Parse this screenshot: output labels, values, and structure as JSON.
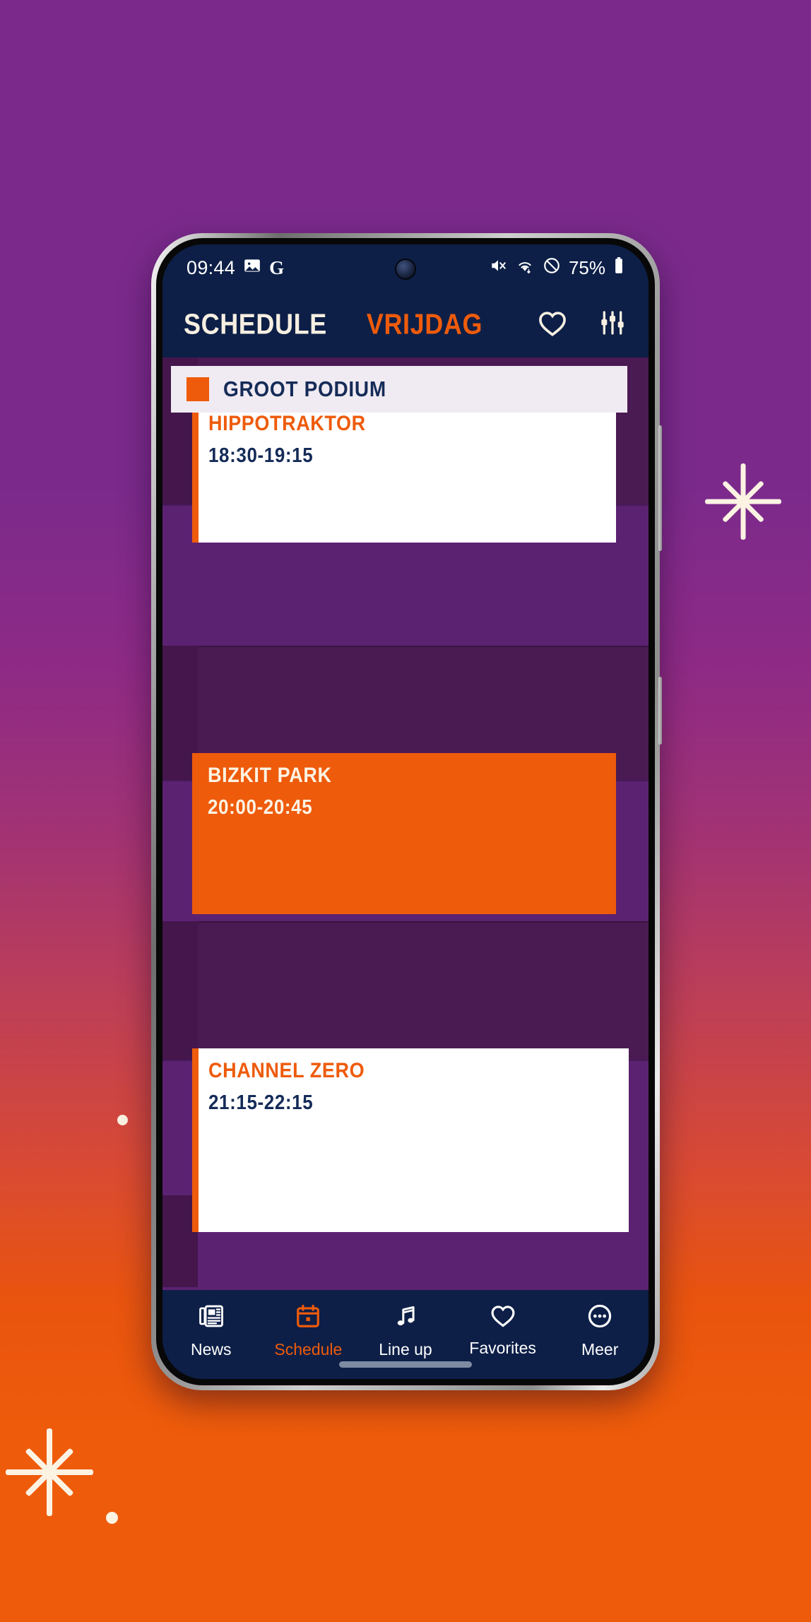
{
  "theme": {
    "orange": "#EE5B0B",
    "navy": "#0D1F47",
    "navy_text": "#152B58",
    "cream": "#FCF3E3",
    "purple_light": "#5C2272",
    "purple_dark": "#4A1A52",
    "bg_top": "#7B2A8C",
    "bg_bottom": "#EE5B0B"
  },
  "statusbar": {
    "time": "09:44",
    "left_icons": [
      "image-icon",
      "google-icon"
    ],
    "right_icons": [
      "mute-icon",
      "wifi-icon",
      "do-not-disturb-icon"
    ],
    "battery_percent": "75%",
    "battery_icon": "battery-icon"
  },
  "appbar": {
    "title": "SCHEDULE",
    "day": "VRIJDAG",
    "favorites_icon": "heart-icon",
    "filter_icon": "sliders-icon"
  },
  "stage": {
    "name": "GROOT PODIUM",
    "color_swatch": "#EE5B0B"
  },
  "events": [
    {
      "name": "HIPPOTRAKTOR",
      "time": "18:30-19:15",
      "style": "light"
    },
    {
      "name": "BIZKIT PARK",
      "time": "20:00-20:45",
      "style": "solid"
    },
    {
      "name": "CHANNEL ZERO",
      "time": "21:15-22:15",
      "style": "light"
    }
  ],
  "navbar": {
    "items": [
      {
        "label": "News",
        "icon": "newspaper-icon",
        "active": false
      },
      {
        "label": "Schedule",
        "icon": "calendar-icon",
        "active": true
      },
      {
        "label": "Line up",
        "icon": "music-note-icon",
        "active": false
      },
      {
        "label": "Favorites",
        "icon": "heart-icon",
        "active": false
      },
      {
        "label": "Meer",
        "icon": "more-dots-icon",
        "active": false
      }
    ]
  }
}
